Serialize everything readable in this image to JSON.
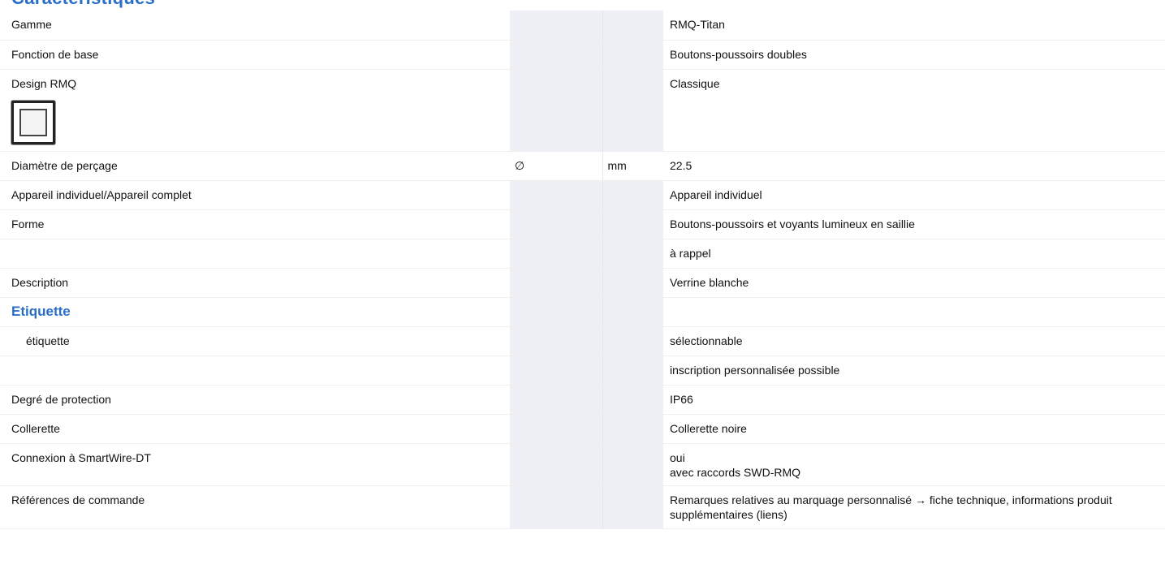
{
  "header": {
    "title": "Caractéristiques"
  },
  "rows": {
    "gamme": {
      "label": "Gamme",
      "value": "RMQ-Titan"
    },
    "fonction": {
      "label": "Fonction de base",
      "value": "Boutons-poussoirs doubles"
    },
    "design": {
      "label": "Design RMQ",
      "value": "Classique"
    },
    "diametre": {
      "label": "Diamètre de perçage",
      "symbol": "∅",
      "unit": "mm",
      "value": "22.5"
    },
    "appareil": {
      "label": "Appareil individuel/Appareil complet",
      "value": "Appareil individuel"
    },
    "forme": {
      "label": "Forme",
      "value": "Boutons-poussoirs et voyants lumineux en saillie"
    },
    "rappel": {
      "label": "",
      "value": "à rappel"
    },
    "description": {
      "label": "Description",
      "value": "Verrine blanche"
    },
    "etiquette_section": {
      "label": "Etiquette"
    },
    "etiquette": {
      "label": "étiquette",
      "value": "sélectionnable"
    },
    "inscription": {
      "label": "",
      "value": "inscription personnalisée possible"
    },
    "protection": {
      "label": "Degré de protection",
      "value": "IP66"
    },
    "collerette": {
      "label": "Collerette",
      "value": "Collerette noire"
    },
    "smartwire": {
      "label": "Connexion à SmartWire-DT",
      "value_line1": "oui",
      "value_line2": "avec raccords SWD-RMQ"
    },
    "references": {
      "label": "Références de commande",
      "value": "Remarques relatives au marquage personnalisé → fiche technique, informations produit supplémentaires (liens)"
    }
  },
  "icons": {
    "design": "square-frame-icon"
  },
  "colors": {
    "section_heading": "#2a6ec8",
    "shaded_column": "#eef0f5"
  }
}
